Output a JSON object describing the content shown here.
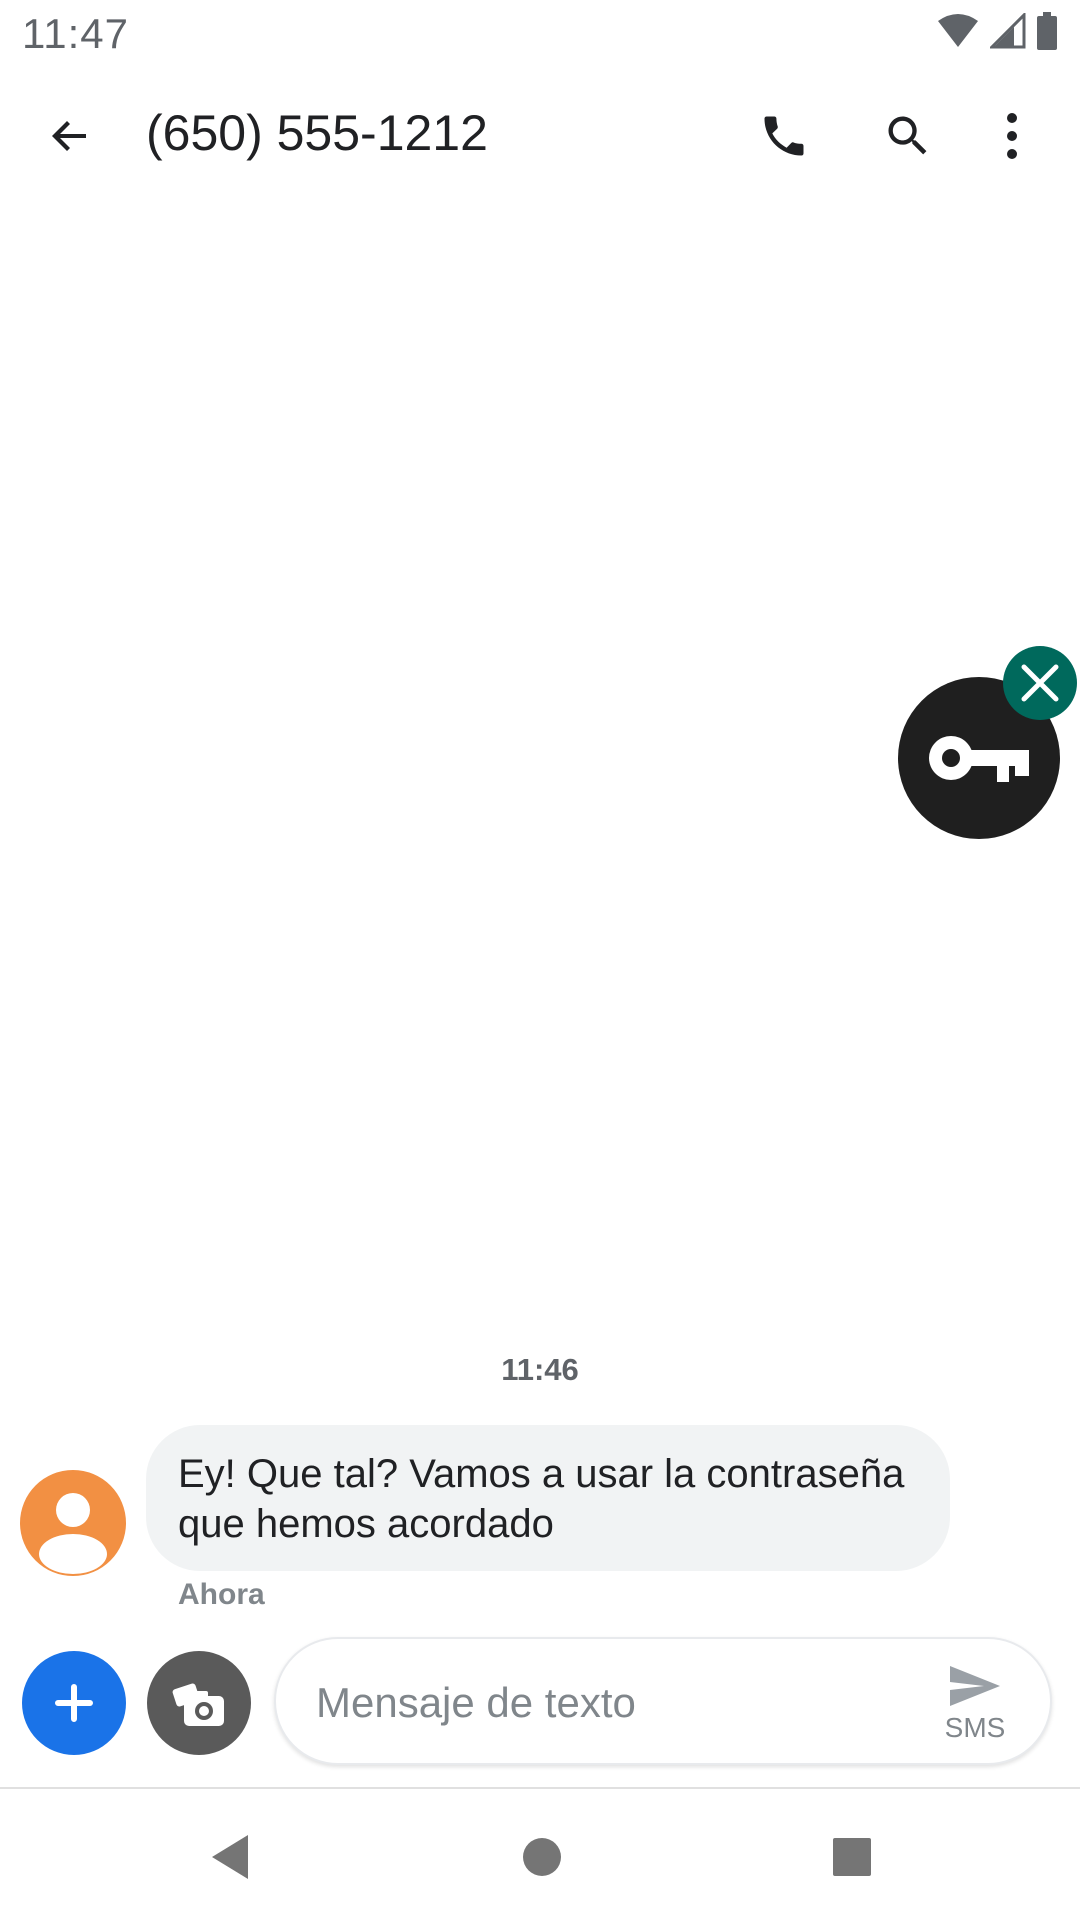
{
  "status_bar": {
    "time": "11:47",
    "icons": [
      "wifi-icon",
      "signal-icon",
      "battery-icon"
    ]
  },
  "app_bar": {
    "title": "(650) 555-1212",
    "icons": [
      "back-arrow-icon",
      "phone-icon",
      "search-icon",
      "more-vert-icon"
    ]
  },
  "conversation": {
    "timestamp": "11:46",
    "messages": [
      {
        "text_line1": "Ey! Que tal? Vamos a usar la contraseña",
        "text_line2": "que hemos acordado",
        "status": "Ahora",
        "avatar_color": "#f29043"
      }
    ]
  },
  "compose": {
    "placeholder": "Mensaje de texto",
    "send_label": "SMS",
    "add_icon": "plus-icon",
    "camera_icon": "camera-icon",
    "accent_color": "#1a73e8"
  },
  "floating_bubble": {
    "icon": "key-icon",
    "close_icon": "close-icon",
    "close_color": "#00695c"
  },
  "nav_bar": {
    "icons": [
      "back-triangle-icon",
      "home-circle-icon",
      "recents-square-icon"
    ]
  }
}
